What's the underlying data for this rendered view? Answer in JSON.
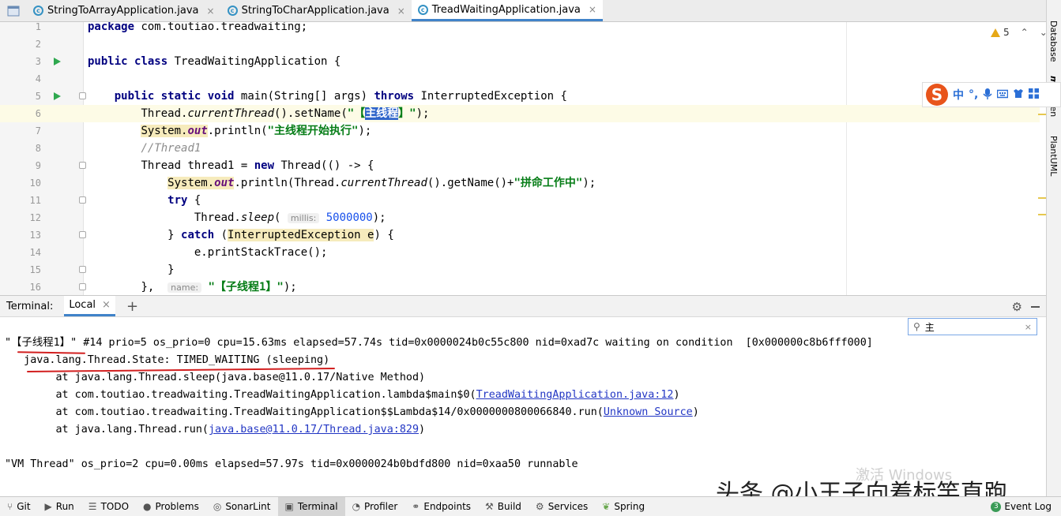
{
  "editor_tabs": [
    {
      "label": "StringToArrayApplication.java",
      "active": false
    },
    {
      "label": "StringToCharApplication.java",
      "active": false
    },
    {
      "label": "TreadWaitingApplication.java",
      "active": true
    }
  ],
  "tab_close_glyph": "×",
  "warnings": {
    "count": "5"
  },
  "right_panels": [
    "Database",
    "m",
    "ven",
    "PlantUML"
  ],
  "ime_toolbar": {
    "logo": "S",
    "mode": "中",
    "punct": "°,"
  },
  "code": {
    "line_numbers": [
      "1",
      "2",
      "3",
      "4",
      "5",
      "6",
      "7",
      "8",
      "9",
      "10",
      "11",
      "12",
      "13",
      "14",
      "15",
      "16"
    ],
    "l1": {
      "kw": "package",
      "rest": " com.toutiao.treadwaiting;"
    },
    "l3": {
      "kw1": "public",
      "kw2": "class",
      "rest": " TreadWaitingApplication {"
    },
    "l5": {
      "kw1": "public",
      "kw2": "static",
      "kw3": "void",
      "mid": " main(String[] args) ",
      "kw4": "throws",
      "rest": " InterruptedException {"
    },
    "l6": {
      "a": "Thread.",
      "b": "currentThread",
      "c": "().setName(",
      "s1": "\"【",
      "sel": "主线程",
      "s2": "】\"",
      "d": ");"
    },
    "l7": {
      "a": "System.",
      "b": "out",
      "c": ".println(",
      "s": "\"主线程开始执行\"",
      "d": ");"
    },
    "l8": {
      "c": "//Thread1"
    },
    "l9": {
      "a": "Thread thread1 = ",
      "kw": "new",
      "b": " Thread(() -> {"
    },
    "l10": {
      "a": "System.",
      "b": "out",
      "c": ".println(Thread.",
      "d": "currentThread",
      "e": "().getName()+",
      "s": "\"拼命工作中\"",
      "f": ");"
    },
    "l11": {
      "kw": "try",
      "rest": " {"
    },
    "l12": {
      "a": "Thread.",
      "b": "sleep",
      "c": "(",
      "hint": "millis:",
      "num": "5000000",
      "d": ");"
    },
    "l13": {
      "a": "} ",
      "kw": "catch",
      "b": " (",
      "ex": "InterruptedException e",
      "c": ") {"
    },
    "l14": {
      "a": "e.printStackTrace();"
    },
    "l15": {
      "a": "}"
    },
    "l16": {
      "a": "}, ",
      "hint": "name:",
      "s": "\"【子线程1】\"",
      "b": ");"
    }
  },
  "terminal": {
    "title": "Terminal:",
    "tab": "Local",
    "tab_close": "×",
    "plus": "+",
    "gear": "⚙",
    "search_value": "主",
    "search_clear": "×",
    "lines": {
      "l1a": "\"【子线程1】\"",
      "l1b": " #14 prio=5 os_prio=0 cpu=15.63ms elapsed=57.74s tid=0x0000024b0c55c800 nid=0xad7c waiting on condition  [0x000000c8b6fff000]",
      "l2": "   java.lang.Thread.State: TIMED_WAITING (sleeping)",
      "l3": "        at java.lang.Thread.sleep(java.base@11.0.17/Native Method)",
      "l4a": "        at com.toutiao.treadwaiting.TreadWaitingApplication.lambda$main$0(",
      "l4link": "TreadWaitingApplication.java:12",
      "l4b": ")",
      "l5a": "        at com.toutiao.treadwaiting.TreadWaitingApplication$$Lambda$14/0x0000000800066840.run(",
      "l5link": "Unknown Source",
      "l5b": ")",
      "l6a": "        at java.lang.Thread.run(",
      "l6link": "java.base@11.0.17/Thread.java:829",
      "l6b": ")",
      "l8": "\"VM Thread\" os_prio=2 cpu=0.00ms elapsed=57.97s tid=0x0000024b0bdfd800 nid=0xaa50 runnable"
    }
  },
  "watermarks": {
    "windows": "激活 Windows",
    "toutiao": "头条 @小王子向着标竿直跑"
  },
  "statusbar": {
    "items": [
      "Git",
      "Run",
      "TODO",
      "Problems",
      "SonarLint",
      "Terminal",
      "Profiler",
      "Endpoints",
      "Build",
      "Services",
      "Spring"
    ],
    "active": "Terminal",
    "event_log": "Event Log",
    "event_badge": "3"
  },
  "colors": {
    "accent": "#4083c9",
    "keyword": "#000080",
    "string": "#067d17",
    "run": "#2fa84f",
    "underline": "#d22020"
  }
}
